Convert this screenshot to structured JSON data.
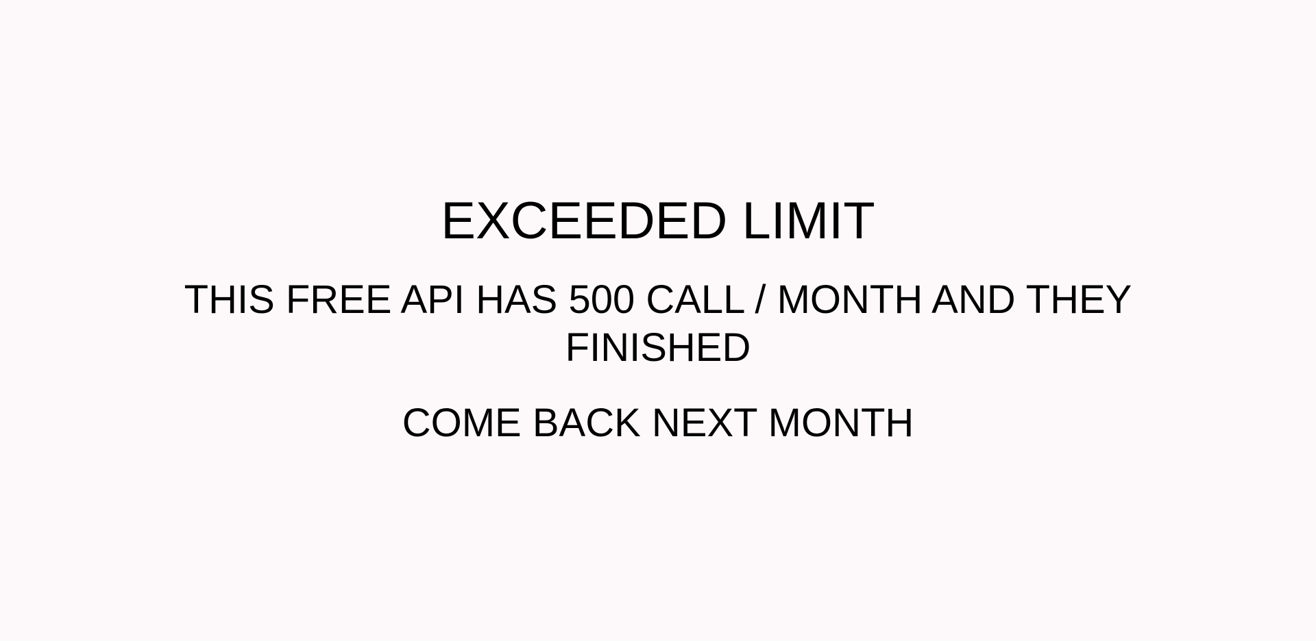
{
  "error": {
    "title": "EXCEEDED LIMIT",
    "detail": "THIS FREE API HAS 500 CALL / MONTH AND THEY FINISHED",
    "hint": "COME BACK NEXT MONTH"
  }
}
